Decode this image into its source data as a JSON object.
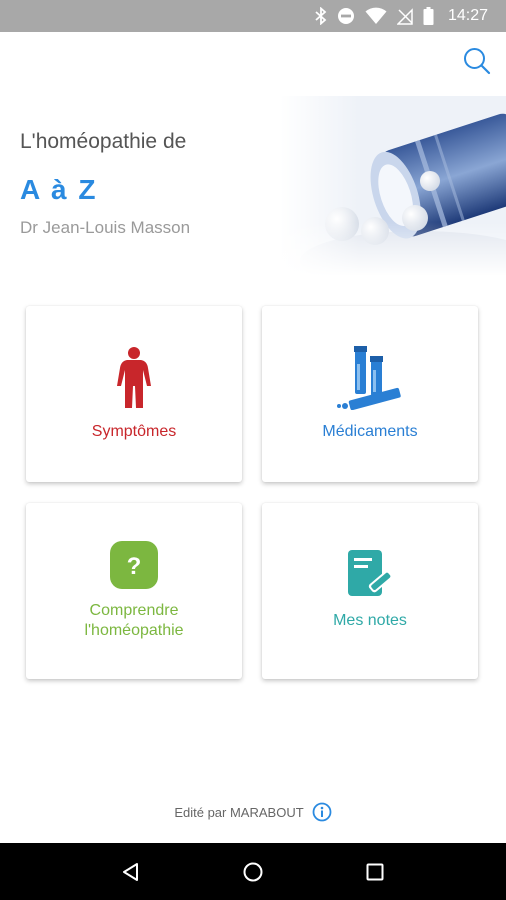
{
  "status_bar": {
    "time": "14:27",
    "icons": [
      "bluetooth-icon",
      "do-not-disturb-icon",
      "wifi-icon",
      "no-signal-icon",
      "battery-icon"
    ]
  },
  "header": {
    "search_icon": "search-icon"
  },
  "hero": {
    "subtitle": "L'homéopathie de",
    "title": "A à Z",
    "author": "Dr Jean-Louis Masson"
  },
  "menu": {
    "symptomes": {
      "label": "Symptômes",
      "color": "#c8262b",
      "icon": "human-body-icon"
    },
    "medicaments": {
      "label": "Médicaments",
      "color": "#2a7fd4",
      "icon": "medicine-tubes-icon"
    },
    "comprendre": {
      "label_line1": "Comprendre",
      "label_line2": "l'homéopathie",
      "color": "#7cb740",
      "icon": "question-icon"
    },
    "notes": {
      "label": "Mes notes",
      "color": "#2fa9a7",
      "icon": "notes-icon"
    }
  },
  "footer": {
    "text": "Edité par MARABOUT",
    "info_icon": "info-icon",
    "accent": "#2a8ae0"
  },
  "nav": {
    "back_icon": "back-icon",
    "home_icon": "home-icon",
    "recents_icon": "recents-icon"
  }
}
